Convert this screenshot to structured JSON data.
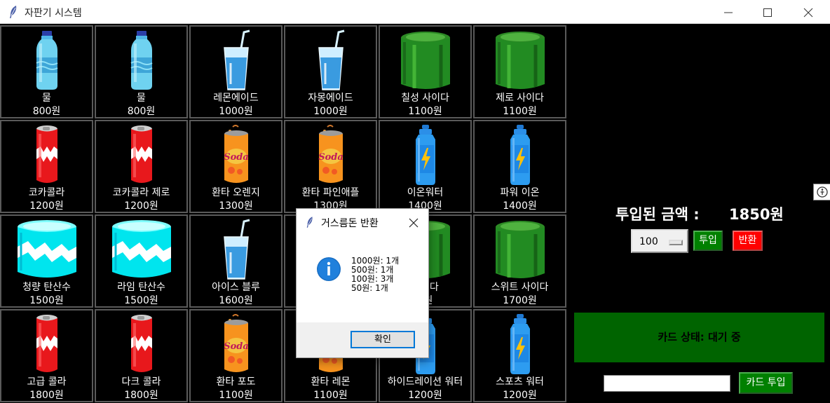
{
  "window": {
    "title": "자판기 시스템"
  },
  "products": [
    {
      "name": "물",
      "price": "800원",
      "icon": "water-bottle"
    },
    {
      "name": "물",
      "price": "800원",
      "icon": "water-bottle"
    },
    {
      "name": "레몬에이드",
      "price": "1000원",
      "icon": "glass-with-straw"
    },
    {
      "name": "자몽에이드",
      "price": "1000원",
      "icon": "glass-with-straw"
    },
    {
      "name": "칠성 사이다",
      "price": "1100원",
      "icon": "green-can"
    },
    {
      "name": "제로 사이다",
      "price": "1100원",
      "icon": "green-can"
    },
    {
      "name": "코카콜라",
      "price": "1200원",
      "icon": "cola-can"
    },
    {
      "name": "코카콜라 제로",
      "price": "1200원",
      "icon": "cola-can"
    },
    {
      "name": "환타 오렌지",
      "price": "1300원",
      "icon": "soda-can"
    },
    {
      "name": "환타 파인애플",
      "price": "1300원",
      "icon": "soda-can"
    },
    {
      "name": "이온워터",
      "price": "1400원",
      "icon": "sports-bottle"
    },
    {
      "name": "파워 이온",
      "price": "1400원",
      "icon": "sports-bottle"
    },
    {
      "name": "청량 탄산수",
      "price": "1500원",
      "icon": "cyan-can"
    },
    {
      "name": "라임 탄산수",
      "price": "1500원",
      "icon": "cyan-can"
    },
    {
      "name": "아이스 블루",
      "price": "1600원",
      "icon": "glass-with-straw"
    },
    {
      "name": "",
      "price": "",
      "icon": "glass-with-straw"
    },
    {
      "name": "사이다",
      "price": "0원",
      "icon": "green-can"
    },
    {
      "name": "스위트 사이다",
      "price": "1700원",
      "icon": "green-can"
    },
    {
      "name": "고급 콜라",
      "price": "1800원",
      "icon": "cola-can"
    },
    {
      "name": "다크 콜라",
      "price": "1800원",
      "icon": "cola-can"
    },
    {
      "name": "환타 포도",
      "price": "1100원",
      "icon": "soda-can"
    },
    {
      "name": "환타 레몬",
      "price": "1100원",
      "icon": "soda-can"
    },
    {
      "name": "하이드레이션 워터",
      "price": "1200원",
      "icon": "sports-bottle"
    },
    {
      "name": "스포츠 워터",
      "price": "1200원",
      "icon": "sports-bottle"
    }
  ],
  "panel": {
    "amount_label": "투입된 금액 :",
    "amount_value": "1850원",
    "coin_select_value": "100",
    "insert_button": "투입",
    "return_button": "반환",
    "card_status": "카드 상태: 대기 중",
    "card_input_value": "",
    "card_button": "카드 투입"
  },
  "dialog": {
    "title": "거스름돈 반환",
    "lines": [
      "1000원: 1개",
      "500원: 1개",
      "100원: 3개",
      "50원: 1개"
    ],
    "ok_button": "확인"
  },
  "colors": {
    "cell_border": "#5a5a5a",
    "green_button": "#008000",
    "red_button": "#ff0000",
    "card_status_bg": "#006400",
    "info_blue": "#0078d7"
  }
}
